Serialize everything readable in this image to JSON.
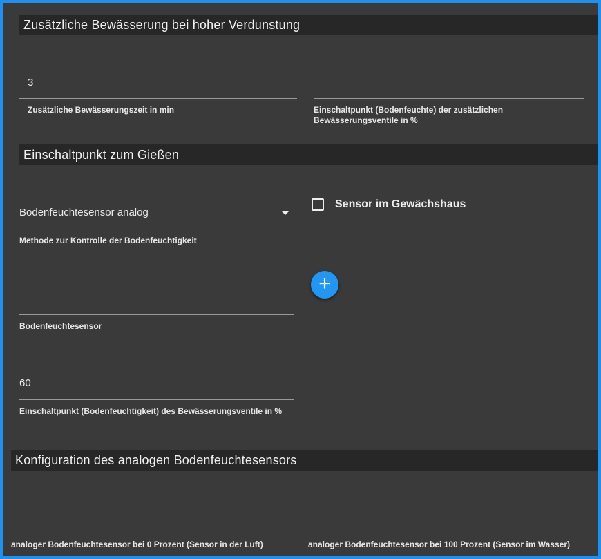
{
  "section1": {
    "title": "Zusätzliche Bewässerung bei hoher Verdunstung",
    "extra_time": {
      "value": "3",
      "label": "Zusätzliche Bewässerungszeit in min"
    },
    "extra_threshold": {
      "value": "",
      "label": "Einschaltpunkt (Bodenfeuchte) der zusätzlichen Bewässerungsventile in %"
    }
  },
  "section2": {
    "title": "Einschaltpunkt zum Gießen",
    "method": {
      "value": "Bodenfeuchtesensor analog",
      "label": "Methode zur Kontrolle der Bodenfeuchtigkeit"
    },
    "greenhouse": {
      "label": "Sensor im Gewächshaus",
      "checked": false
    },
    "add_button": "+",
    "sensor": {
      "value": "",
      "label": "Bodenfeuchtesensor"
    },
    "threshold": {
      "value": "60",
      "label": "Einschaltpunkt (Bodenfeuchtigkeit) des Bewässerungsventile in %"
    }
  },
  "section3": {
    "title": "Konfiguration des analogen Bodenfeuchtesensors",
    "air": {
      "value": "",
      "label": "analoger Bodenfeuchtesensor bei 0 Prozent (Sensor in der Luft)"
    },
    "water": {
      "value": "",
      "label": "analoger Bodenfeuchtesensor bei 100 Prozent (Sensor im Wasser)"
    }
  }
}
